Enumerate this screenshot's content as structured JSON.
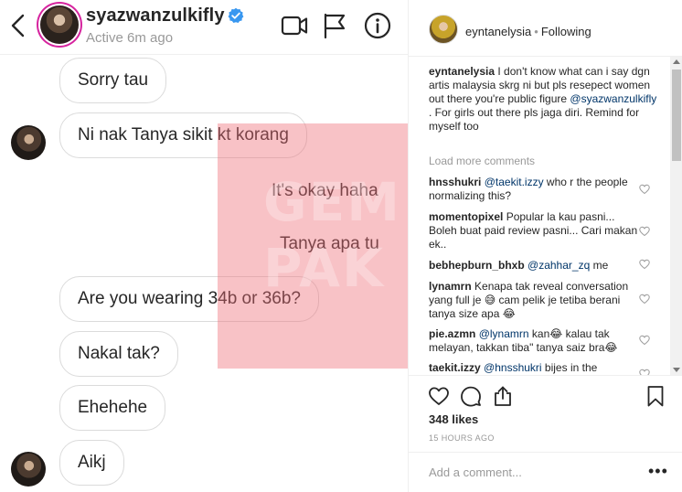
{
  "dm": {
    "username": "syazwanzulkifly",
    "status": "Active 6m ago",
    "icons": {
      "back": "chevron-left-icon",
      "verified": "verified-badge-icon",
      "video": "video-call-icon",
      "report": "flag-icon",
      "info": "info-icon"
    },
    "messages": [
      {
        "text": "Sorry tau",
        "from": "them"
      },
      {
        "text": "Ni nak Tanya sikit kt korang",
        "from": "them"
      },
      {
        "text": "It's okay haha",
        "from": "me"
      },
      {
        "text": "Tanya apa tu",
        "from": "me"
      },
      {
        "text": "Are you wearing 34b or 36b?",
        "from": "them"
      },
      {
        "text": "Nakal tak?",
        "from": "them"
      },
      {
        "text": "Ehehehe",
        "from": "them"
      },
      {
        "text": "Aikj",
        "from": "them"
      }
    ],
    "watermark": {
      "line1": "GEM",
      "line2": "PAK",
      "color": "#ef6e78"
    }
  },
  "post": {
    "username": "eyntanelysia",
    "follow_status": "Following",
    "caption_user": "eyntanelysia",
    "caption_text_before": " I don't know what can i say dgn artis malaysia skrg ni but pls resepect women out there you're public figure ",
    "caption_mention": "@syazwanzulkifly",
    "caption_text_after": " . For girls out there pls jaga diri. Remind for myself too",
    "load_more": "Load more comments",
    "comments": [
      {
        "user": "hnsshukri",
        "mention": "@taekit.izzy",
        "text": " who r the people normalizing this?"
      },
      {
        "user": "momentopixel",
        "mention": "",
        "text": " Popular la kau pasni... Boleh buat paid review pasni... Cari makan ek.."
      },
      {
        "user": "bebhepburn_bhxb",
        "mention": "@zahhar_zq",
        "text": " me"
      },
      {
        "user": "lynamrn",
        "mention": "",
        "text": " Kenapa tak reveal conversation yang full je 😅 cam pelik je tetiba berani tanya size apa 😂"
      },
      {
        "user": "pie.azmn",
        "mention": "@lynamrn",
        "text": " kan😂 kalau tak melayan, takkan tiba\" tanya saiz bra😂"
      },
      {
        "user": "taekit.izzy",
        "mention": "@hnsshukri",
        "text": " bijes in the"
      }
    ],
    "likes": "348 likes",
    "time_ago": "15 HOURS AGO",
    "add_comment_placeholder": "Add a comment...",
    "more": "•••",
    "icons": {
      "like": "heart-icon",
      "comment": "comment-bubble-icon",
      "share": "share-icon",
      "save": "bookmark-icon",
      "comment_like": "small-heart-icon"
    }
  }
}
